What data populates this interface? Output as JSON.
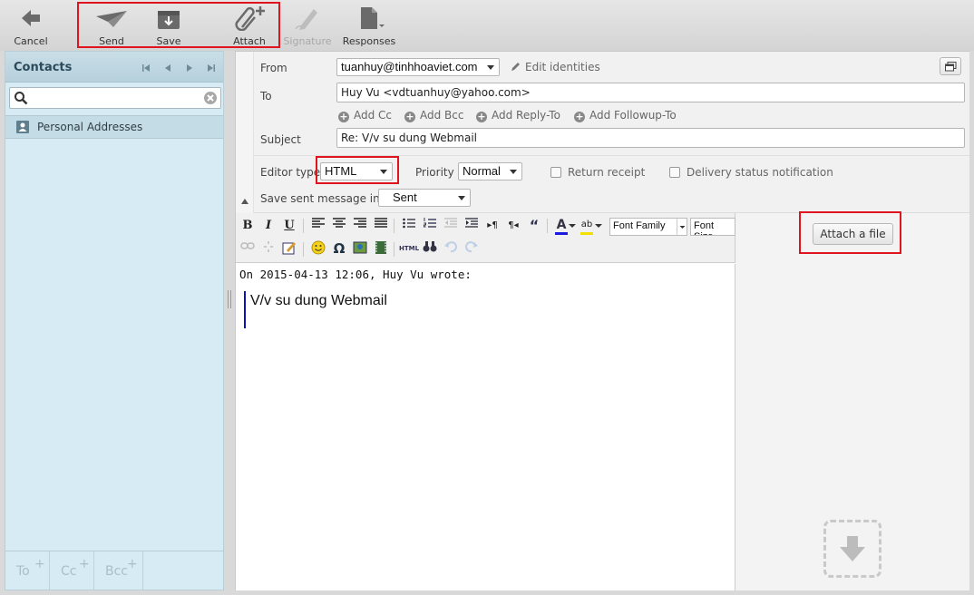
{
  "toolbar": {
    "cancel": "Cancel",
    "send": "Send",
    "save": "Save",
    "attach": "Attach",
    "signature": "Signature",
    "responses": "Responses"
  },
  "contacts": {
    "title": "Contacts",
    "search_value": "",
    "address_book": "Personal Addresses",
    "footer": {
      "to": "To",
      "cc": "Cc",
      "bcc": "Bcc"
    }
  },
  "compose": {
    "from_label": "From",
    "from_value": "tuanhuy@tinhhoaviet.com",
    "edit_identities": "Edit identities",
    "to_label": "To",
    "to_value": "Huy Vu <vdtuanhuy@yahoo.com>",
    "add_cc": "Add Cc",
    "add_bcc": "Add Bcc",
    "add_reply_to": "Add Reply-To",
    "add_followup_to": "Add Followup-To",
    "subject_label": "Subject",
    "subject_value": "Re: V/v su dung Webmail",
    "editor_type_label": "Editor type",
    "editor_type_value": "HTML",
    "priority_label": "Priority",
    "priority_value": "Normal",
    "return_receipt": "Return receipt",
    "delivery_status": "Delivery status notification",
    "save_sent_label": "Save sent message in",
    "save_sent_value": "Sent"
  },
  "editor": {
    "font_family": "Font Family",
    "font_size": "Font Size",
    "quote_intro": "On 2015-04-13 12:06, Huy Vu wrote:",
    "quote_text": "V/v su dung Webmail"
  },
  "attachments": {
    "attach_file": "Attach a file"
  }
}
